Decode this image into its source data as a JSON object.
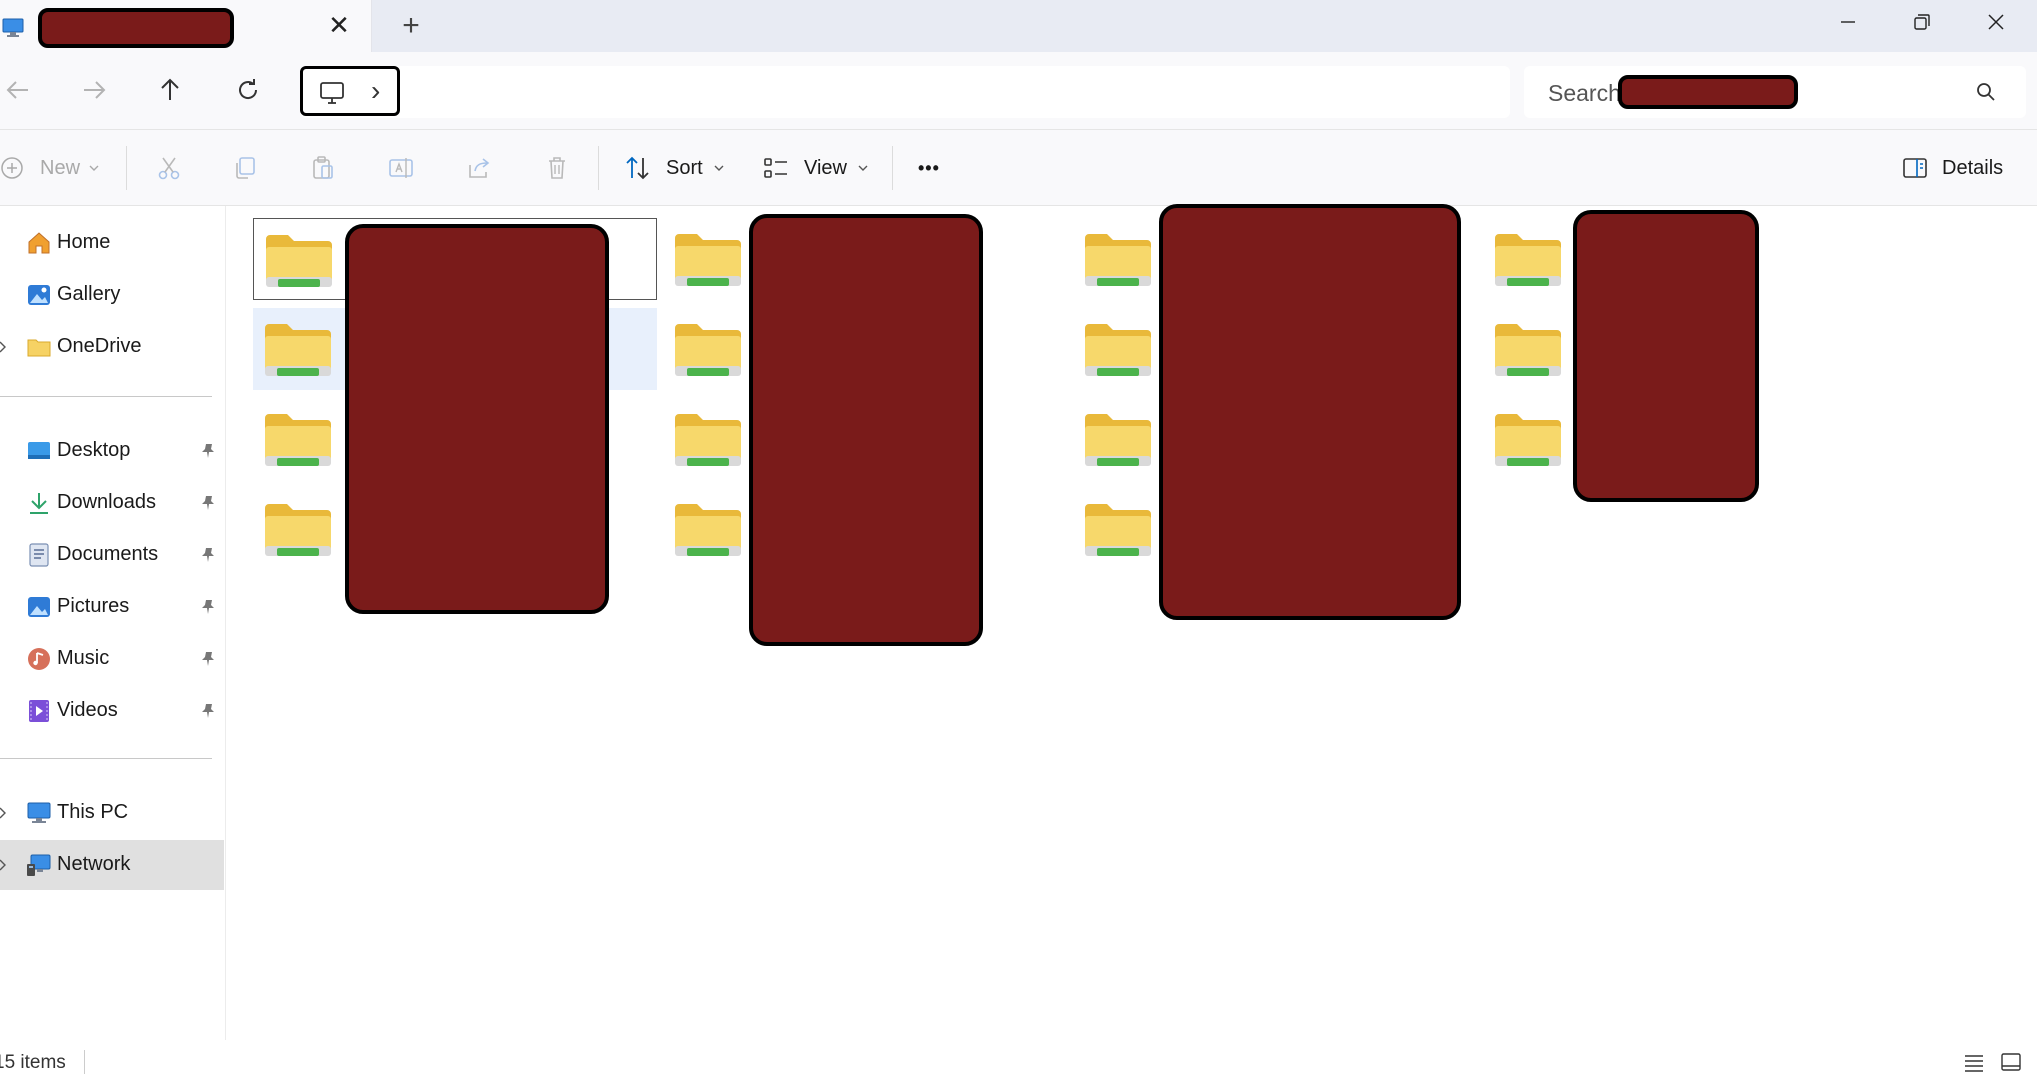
{
  "window": {
    "tab_title": "",
    "tab_close": "✕",
    "new_tab": "+",
    "minimize": "—",
    "maximize": "❐",
    "close": "✕"
  },
  "navigation": {
    "back_icon": "arrow-left-icon",
    "forward_icon": "arrow-right-icon",
    "up_icon": "arrow-up-icon",
    "refresh_icon": "refresh-icon",
    "breadcrumb_chevron": "›"
  },
  "search": {
    "placeholder": "Search",
    "scope": ""
  },
  "toolbar": {
    "new_label": "New",
    "sort_label": "Sort",
    "view_label": "View",
    "more_label": "•••",
    "details_label": "Details",
    "disabled_icons": [
      "cut-icon",
      "copy-icon",
      "paste-icon",
      "rename-icon",
      "share-icon",
      "delete-icon"
    ]
  },
  "sidebar": {
    "items": [
      {
        "label": "Home",
        "icon": "home-icon",
        "pinned": false,
        "expandable": false
      },
      {
        "label": "Gallery",
        "icon": "gallery-icon",
        "pinned": false,
        "expandable": false
      },
      {
        "label": "OneDrive",
        "icon": "folder-icon",
        "pinned": false,
        "expandable": true
      },
      {
        "label": "Desktop",
        "icon": "desktop-icon",
        "pinned": true,
        "expandable": false
      },
      {
        "label": "Downloads",
        "icon": "download-icon",
        "pinned": true,
        "expandable": false
      },
      {
        "label": "Documents",
        "icon": "documents-icon",
        "pinned": true,
        "expandable": false
      },
      {
        "label": "Pictures",
        "icon": "pictures-icon",
        "pinned": true,
        "expandable": false
      },
      {
        "label": "Music",
        "icon": "music-icon",
        "pinned": true,
        "expandable": false
      },
      {
        "label": "Videos",
        "icon": "videos-icon",
        "pinned": true,
        "expandable": false
      },
      {
        "label": "This PC",
        "icon": "computer-icon",
        "pinned": false,
        "expandable": true
      },
      {
        "label": "Network",
        "icon": "network-icon",
        "pinned": false,
        "expandable": true,
        "selected": true
      }
    ]
  },
  "content": {
    "view": "tiles",
    "folder_count_visible": 15,
    "folder_names_redacted": true
  },
  "status": {
    "item_count": "15 items"
  },
  "colors": {
    "accent": "#0067c0",
    "redaction": "#7a1b1a",
    "folder_yellow": "#f6d264",
    "folder_green": "#4cb34c",
    "selected_bg": "#e0e0e0",
    "hover_bg": "#e8f0fc"
  }
}
